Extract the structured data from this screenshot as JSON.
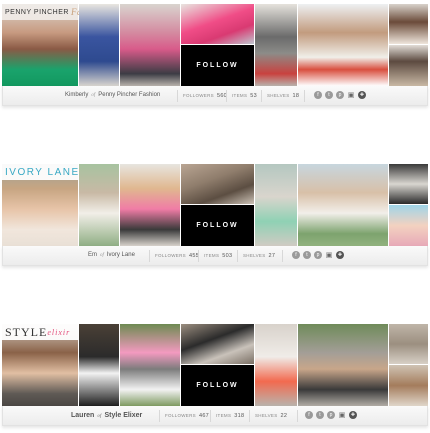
{
  "profiles": [
    {
      "logo_text": "PENNY PINCHER",
      "logo_script": "Fashion",
      "first_name": "Kimberly",
      "of": "of",
      "blog_name": "Penny Pincher Fashion",
      "followers_label": "FOLLOWERS",
      "followers": "560",
      "items_label": "ITEMS",
      "items": "53",
      "shelves_label": "SHELVES",
      "shelves": "18",
      "follow_label": "FOLLOW"
    },
    {
      "logo_text": "IVORY LANE",
      "logo_script": "",
      "first_name": "Em",
      "of": "of",
      "blog_name": "Ivory Lane",
      "followers_label": "FOLLOWERS",
      "followers": "455",
      "items_label": "ITEMS",
      "items": "503",
      "shelves_label": "SHELVES",
      "shelves": "27",
      "follow_label": "FOLLOW"
    },
    {
      "logo_text": "STYLE",
      "logo_script": "elixir",
      "first_name": "Lauren",
      "of": "of",
      "blog_name": "Style Elixer",
      "followers_label": "FOLLOWERS",
      "followers": "467",
      "items_label": "ITEMS",
      "items": "318",
      "shelves_label": "SHELVES",
      "shelves": "22",
      "follow_label": "FOLLOW"
    }
  ],
  "social_icons": [
    "facebook-icon",
    "twitter-icon",
    "pinterest-icon",
    "instagram-icon",
    "blog-icon"
  ],
  "colors": {
    "follow_bg": "#000000",
    "bar_bg": "#f2f2f2",
    "ivory_lane_accent": "#39a9c4",
    "style_elixir_accent": "#e34a79"
  }
}
